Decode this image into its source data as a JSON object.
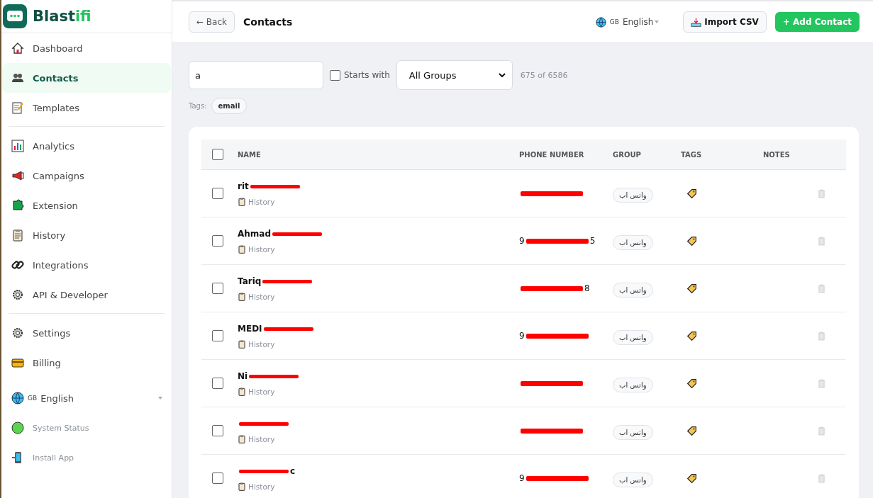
{
  "brand": {
    "name_start": "Blast",
    "name_end": "ifi"
  },
  "sidebar": {
    "groups": [
      [
        {
          "label": "Dashboard",
          "kind": "house",
          "selected": false
        },
        {
          "label": "Contacts",
          "kind": "people",
          "selected": true
        },
        {
          "label": "Templates",
          "kind": "memo",
          "selected": false
        }
      ],
      [
        {
          "label": "Analytics",
          "kind": "chart",
          "selected": false
        },
        {
          "label": "Campaigns",
          "kind": "megaphone",
          "selected": false
        },
        {
          "label": "Extension",
          "kind": "puzzle",
          "selected": false
        },
        {
          "label": "History",
          "kind": "clipboard",
          "selected": false
        },
        {
          "label": "Integrations",
          "kind": "link",
          "selected": false
        },
        {
          "label": "API & Developer",
          "kind": "gear",
          "selected": false
        }
      ],
      [
        {
          "label": "Settings",
          "kind": "gear",
          "selected": false
        },
        {
          "label": "Billing",
          "kind": "card",
          "selected": false
        }
      ]
    ],
    "language": {
      "code": "GB",
      "label": "English"
    },
    "footer": [
      {
        "label": "System Status",
        "kind": "dot"
      },
      {
        "label": "Install App",
        "kind": "phone"
      }
    ]
  },
  "header": {
    "back": "← Back",
    "title": "Contacts",
    "language": {
      "code": "GB",
      "label": "English"
    },
    "import": "Import CSV",
    "add": "+ Add Contact"
  },
  "filters": {
    "search": {
      "value": "a"
    },
    "starts_with": {
      "label": "Starts with",
      "checked": false
    },
    "group": "All Groups",
    "count": "675 of 6586",
    "tags_label": "Tags:",
    "tags": [
      "email"
    ]
  },
  "table": {
    "select_all": {
      "checked": false
    },
    "columns": [
      "NAME",
      "PHONE NUMBER",
      "GROUP",
      "TAGS",
      "NOTES"
    ],
    "rows": [
      {
        "name_start": "rit",
        "history": "History",
        "group": "واتس اب",
        "selected": false
      },
      {
        "name_start": "Ahmad",
        "phone_start": "9",
        "phone_end": "5",
        "history": "History",
        "group": "واتس اب",
        "selected": false
      },
      {
        "name_start": "Tariq",
        "phone_end": "8",
        "history": "History",
        "group": "واتس اب",
        "selected": false
      },
      {
        "name_start": "MEDI",
        "phone_start": "9",
        "history": "History",
        "group": "واتس اب",
        "selected": false
      },
      {
        "name_start": "Ni",
        "history": "History",
        "group": "واتس اب",
        "selected": false
      },
      {
        "history": "History",
        "group": "واتس اب",
        "selected": false
      },
      {
        "name_end": "c",
        "phone_start": "9",
        "history": "History",
        "group": "واتس اب",
        "selected": false
      }
    ]
  }
}
